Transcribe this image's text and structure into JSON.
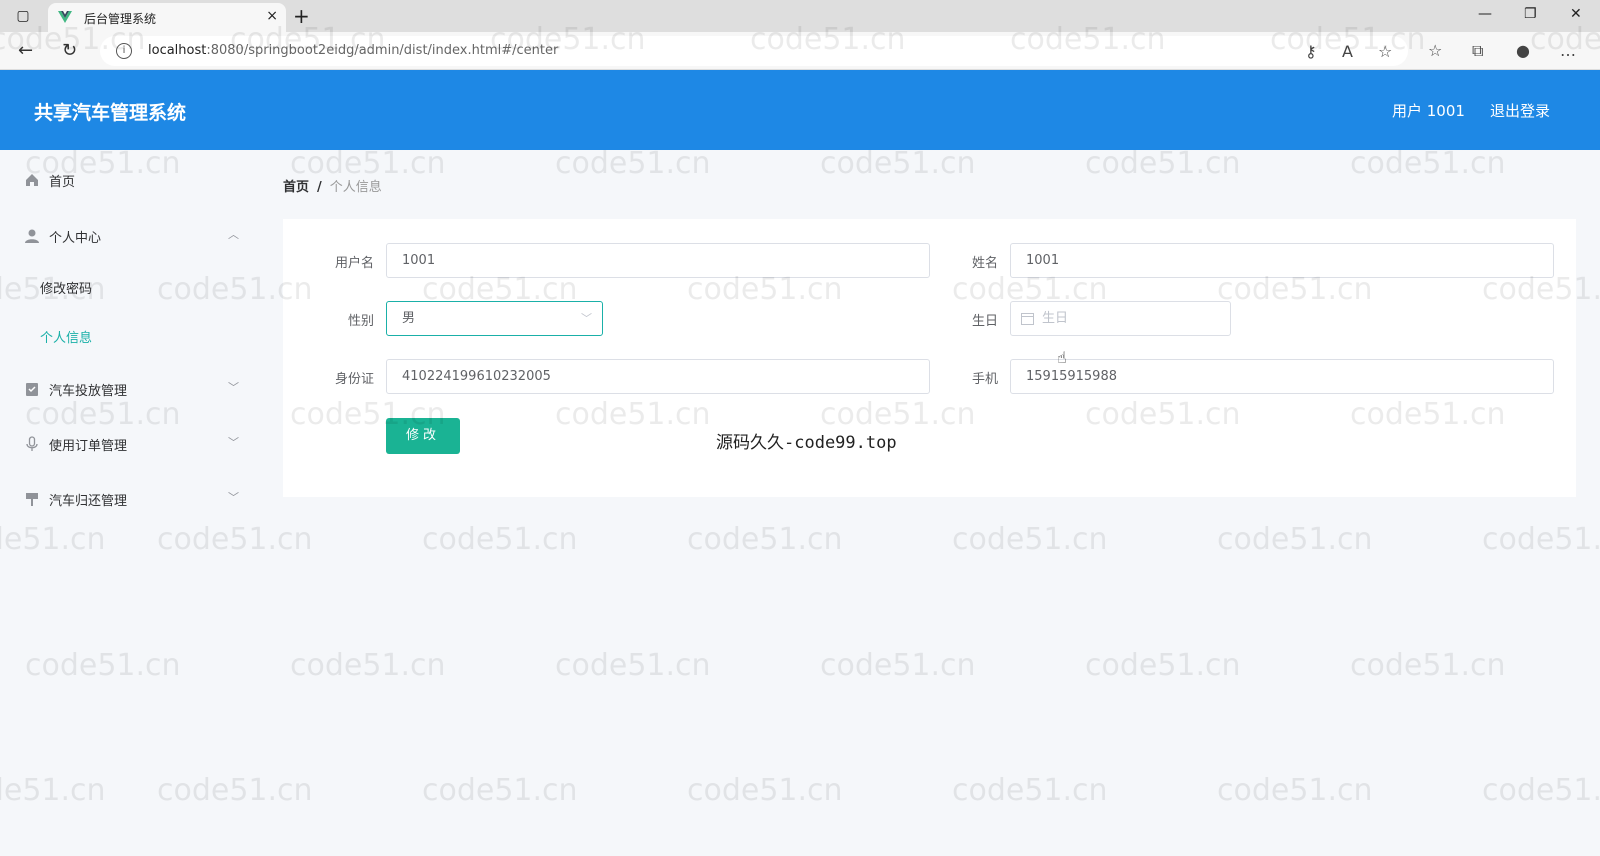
{
  "browser": {
    "tab_title": "后台管理系统",
    "tab_close": "×",
    "new_tab": "+",
    "url_host": "localhost",
    "url_rest": ":8080/springboot2eidg/admin/dist/index.html#/center",
    "url_info": "i"
  },
  "header": {
    "title": "共享汽车管理系统",
    "user": "用户 1001",
    "logout": "退出登录"
  },
  "sidebar": {
    "items": [
      {
        "label": "首页",
        "icon": "home-icon"
      },
      {
        "label": "个人中心",
        "icon": "user-icon",
        "arrow": "︿"
      },
      {
        "label": "汽车投放管理",
        "icon": "clipboard-icon",
        "arrow": "﹀"
      },
      {
        "label": "使用订单管理",
        "icon": "microphone-icon",
        "arrow": "﹀"
      },
      {
        "label": "汽车归还管理",
        "icon": "sign-icon",
        "arrow": "﹀"
      }
    ],
    "sub_items": [
      {
        "label": "修改密码"
      },
      {
        "label": "个人信息"
      }
    ]
  },
  "breadcrumb": {
    "home": "首页",
    "sep": "/",
    "current": "个人信息"
  },
  "form": {
    "username_label": "用户名",
    "username_value": "1001",
    "name_label": "姓名",
    "name_value": "1001",
    "gender_label": "性别",
    "gender_value": "男",
    "birthday_label": "生日",
    "birthday_placeholder": "生日",
    "idcard_label": "身份证",
    "idcard_value": "410224199610232005",
    "phone_label": "手机",
    "phone_value": "15915915988",
    "submit_label": "修改"
  },
  "overlay_text": "源码久久-code99.top",
  "watermark": "code51.cn",
  "colors": {
    "header_bg": "#1e88e5",
    "accent": "#1ab0a8",
    "button": "#1ab394"
  }
}
